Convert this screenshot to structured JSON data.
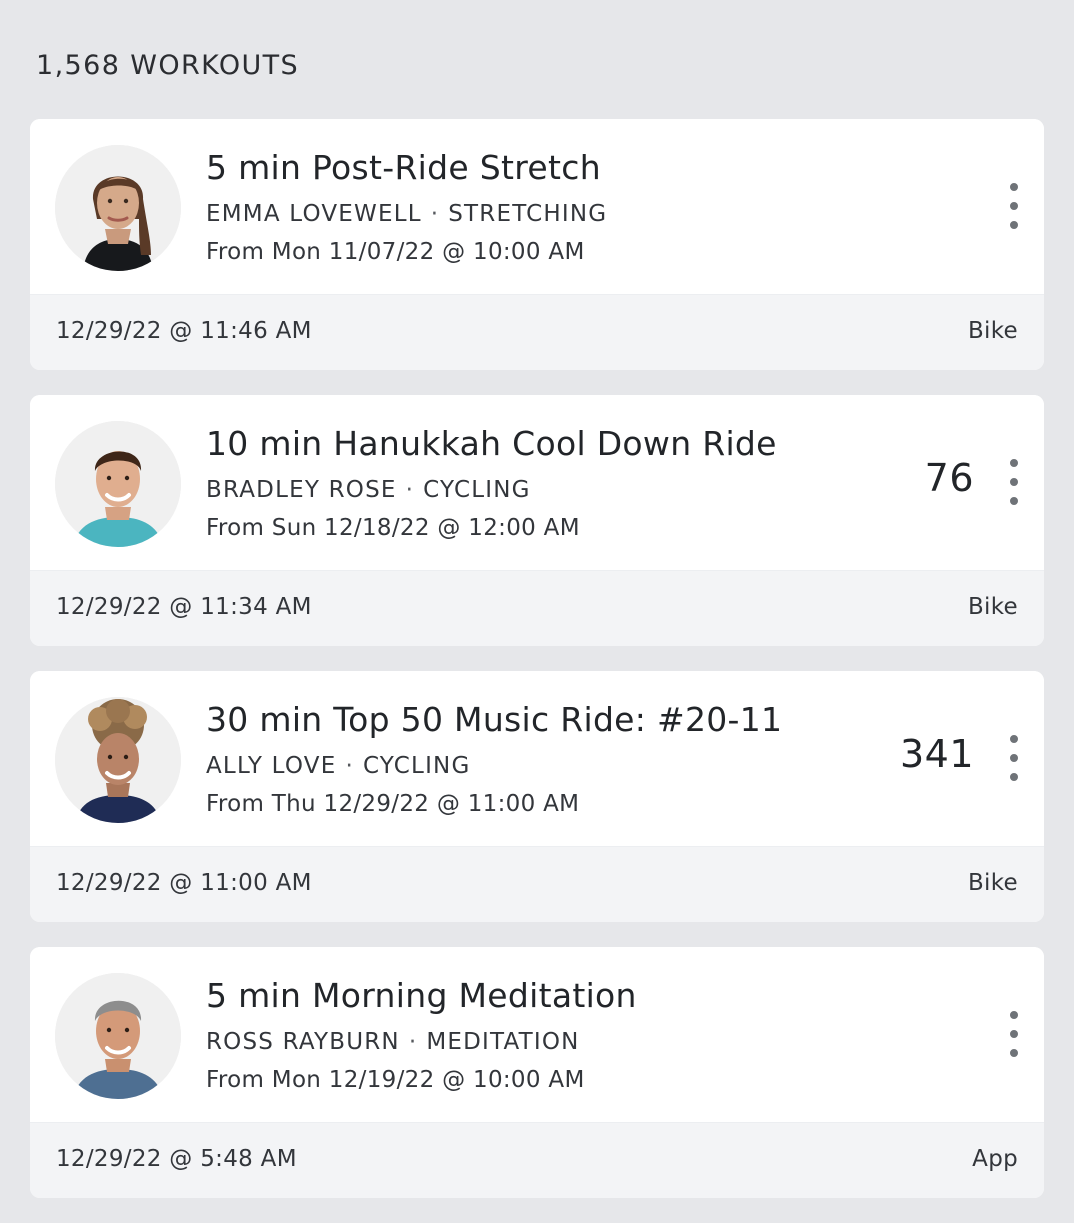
{
  "header": {
    "count_label": "1,568 WORKOUTS"
  },
  "workouts": [
    {
      "title": "5 min Post-Ride Stretch",
      "instructor": "EMMA LOVEWELL",
      "separator": "·",
      "category": "STRETCHING",
      "aired": "From Mon 11/07/22 @ 10:00 AM",
      "output": "",
      "completed_at": "12/29/22 @ 11:46 AM",
      "platform": "Bike"
    },
    {
      "title": "10 min Hanukkah Cool Down Ride",
      "instructor": "BRADLEY ROSE",
      "separator": "·",
      "category": "CYCLING",
      "aired": "From Sun 12/18/22 @ 12:00 AM",
      "output": "76",
      "completed_at": "12/29/22 @ 11:34 AM",
      "platform": "Bike"
    },
    {
      "title": "30 min Top 50 Music Ride: #20-11",
      "instructor": "ALLY LOVE",
      "separator": "·",
      "category": "CYCLING",
      "aired": "From Thu 12/29/22 @ 11:00 AM",
      "output": "341",
      "completed_at": "12/29/22 @ 11:00 AM",
      "platform": "Bike"
    },
    {
      "title": "5 min Morning Meditation",
      "instructor": "ROSS RAYBURN",
      "separator": "·",
      "category": "MEDITATION",
      "aired": "From Mon 12/19/22 @ 10:00 AM",
      "output": "",
      "completed_at": "12/29/22 @ 5:48 AM",
      "platform": "App"
    }
  ],
  "colors": {
    "page_background": "#e6e7ea",
    "card_background": "#ffffff",
    "footer_background": "#f3f4f6",
    "text_primary": "#222529",
    "text_secondary": "#33363b",
    "menu_dots": "#6f7378"
  },
  "icons": {
    "more_menu": "vertical-ellipsis-icon"
  }
}
